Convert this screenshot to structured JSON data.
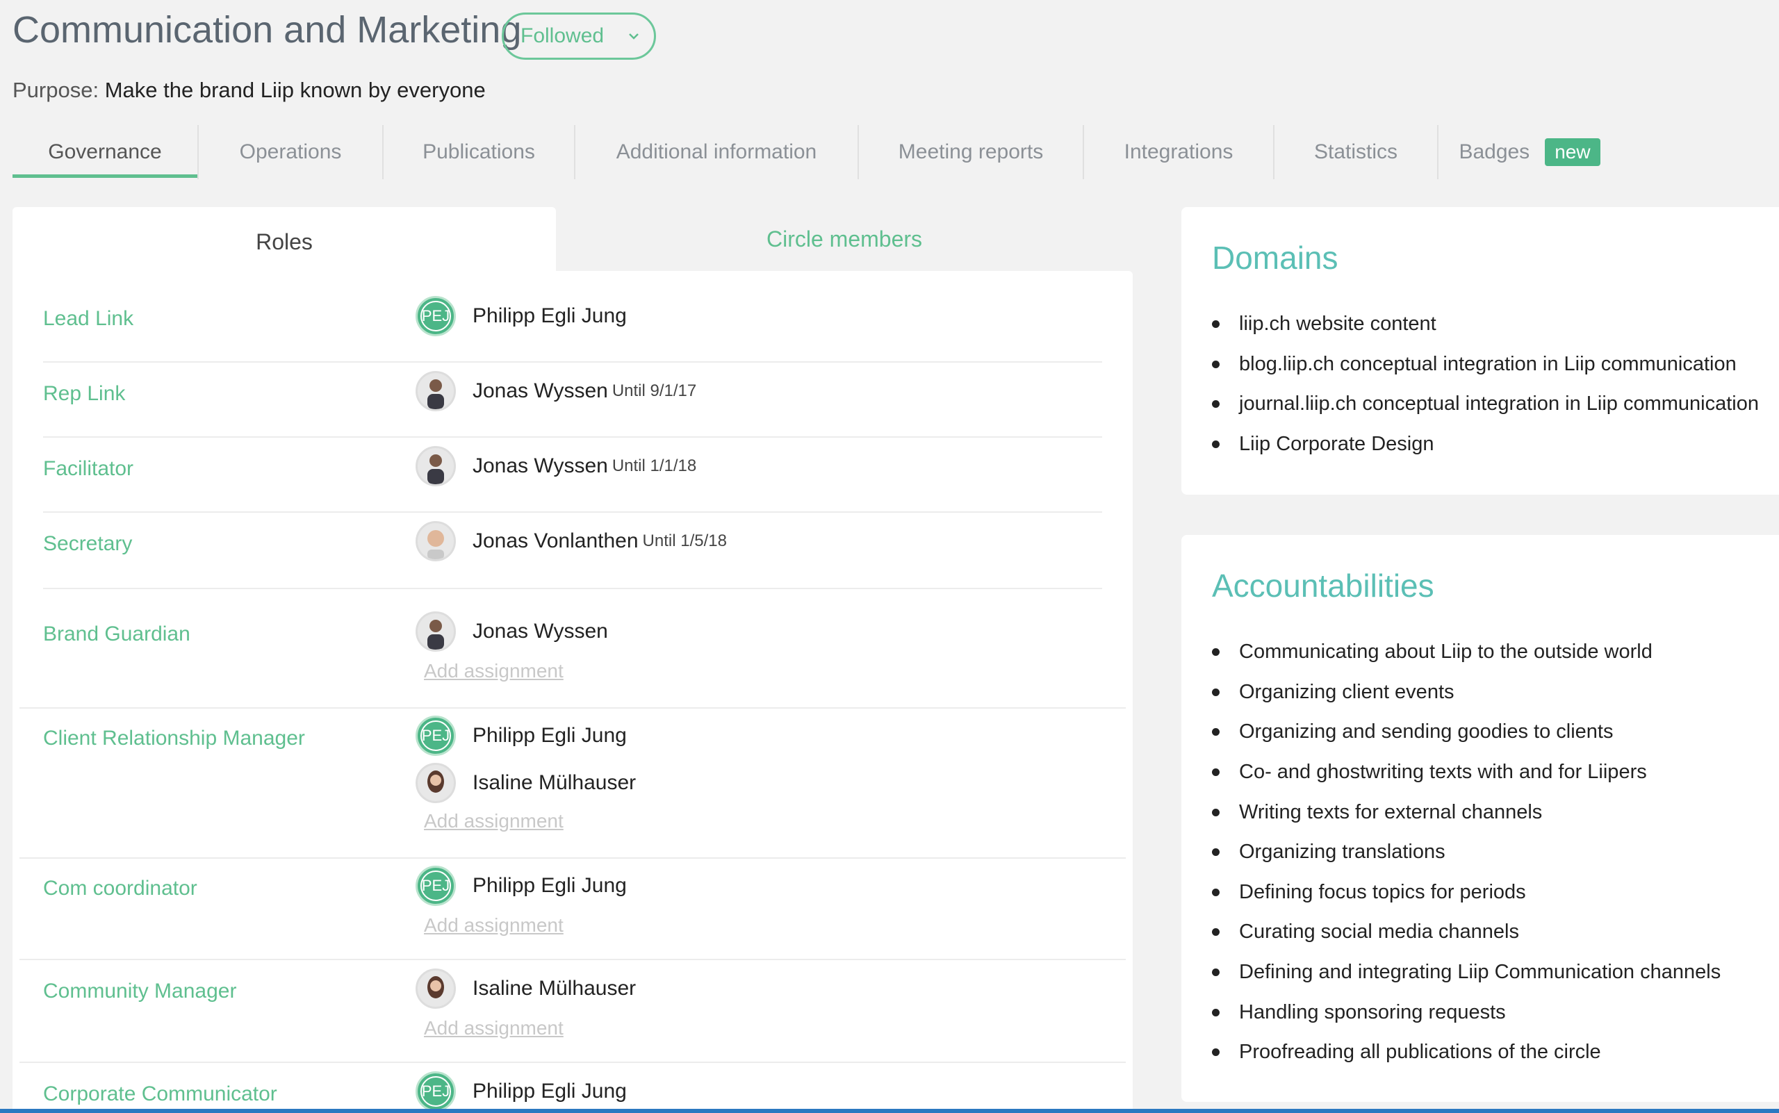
{
  "header": {
    "title": "Communication and Marketing",
    "follow_button": "Followed",
    "purpose_label": "Purpose:",
    "purpose_text": "Make the brand Liip known by everyone"
  },
  "tabs": [
    {
      "label": "Governance",
      "active": true
    },
    {
      "label": "Operations"
    },
    {
      "label": "Publications"
    },
    {
      "label": "Additional information"
    },
    {
      "label": "Meeting reports"
    },
    {
      "label": "Integrations"
    },
    {
      "label": "Statistics"
    },
    {
      "label": "Badges",
      "badge": "new"
    }
  ],
  "subtabs": {
    "roles": "Roles",
    "members": "Circle members"
  },
  "roles": [
    {
      "name": "Lead Link",
      "assignees": [
        {
          "name": "Philipp Egli Jung",
          "initials": "PEJ",
          "until": ""
        }
      ],
      "add": false
    },
    {
      "name": "Rep Link",
      "assignees": [
        {
          "name": "Jonas Wyssen",
          "until": "Until 9/1/17"
        }
      ],
      "add": false
    },
    {
      "name": "Facilitator",
      "assignees": [
        {
          "name": "Jonas Wyssen",
          "until": "Until 1/1/18"
        }
      ],
      "add": false
    },
    {
      "name": "Secretary",
      "assignees": [
        {
          "name": "Jonas Vonlanthen",
          "until": "Until 1/5/18"
        }
      ],
      "add": false
    },
    {
      "name": "Brand Guardian",
      "assignees": [
        {
          "name": "Jonas Wyssen",
          "until": ""
        }
      ],
      "add": "Add assignment"
    },
    {
      "name": "Client Relationship Manager",
      "assignees": [
        {
          "name": "Philipp Egli Jung",
          "initials": "PEJ"
        },
        {
          "name": "Isaline Mülhauser"
        }
      ],
      "add": "Add assignment"
    },
    {
      "name": "Com coordinator",
      "assignees": [
        {
          "name": "Philipp Egli Jung",
          "initials": "PEJ"
        }
      ],
      "add": "Add assignment"
    },
    {
      "name": "Community Manager",
      "assignees": [
        {
          "name": "Isaline Mülhauser"
        }
      ],
      "add": "Add assignment"
    },
    {
      "name": "Corporate Communicator",
      "assignees": [
        {
          "name": "Philipp Egli Jung",
          "initials": "PEJ"
        }
      ],
      "add": false
    }
  ],
  "domains": {
    "title": "Domains",
    "items": [
      "liip.ch website content",
      "blog.liip.ch conceptual integration in Liip communication",
      "journal.liip.ch conceptual integration in Liip communication",
      "Liip Corporate Design"
    ]
  },
  "accountabilities": {
    "title": "Accountabilities",
    "items": [
      "Communicating about Liip to the outside world",
      "Organizing client events",
      "Organizing and sending goodies to clients",
      "Co- and ghostwriting texts with and for Liipers",
      "Writing texts for external channels",
      "Organizing translations",
      "Defining focus topics for periods",
      "Curating social media channels",
      "Defining and integrating Liip Communication channels",
      "Handling sponsoring requests",
      "Proofreading all publications of the circle"
    ]
  },
  "colors": {
    "accent": "#5fbf8f",
    "heading": "#5bbfb5",
    "badge": "#4cb687"
  }
}
